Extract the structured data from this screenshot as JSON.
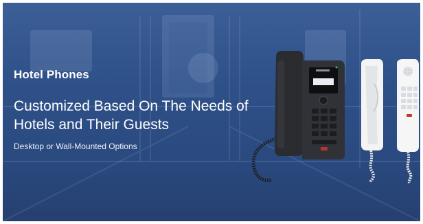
{
  "banner": {
    "title": "Hotel Phones",
    "headline": "Customized Based On The Needs of Hotels and Their Guests",
    "options": "Desktop or Wall-Mounted Options"
  },
  "colors": {
    "overlay": "#2f5189",
    "text": "#ffffff",
    "phone_desk": "#2b2d31",
    "phone_wall": "#f2f2f2"
  },
  "icons": [
    "desk-phone-image",
    "wall-phone-white-image",
    "wall-phone-keypad-image"
  ]
}
